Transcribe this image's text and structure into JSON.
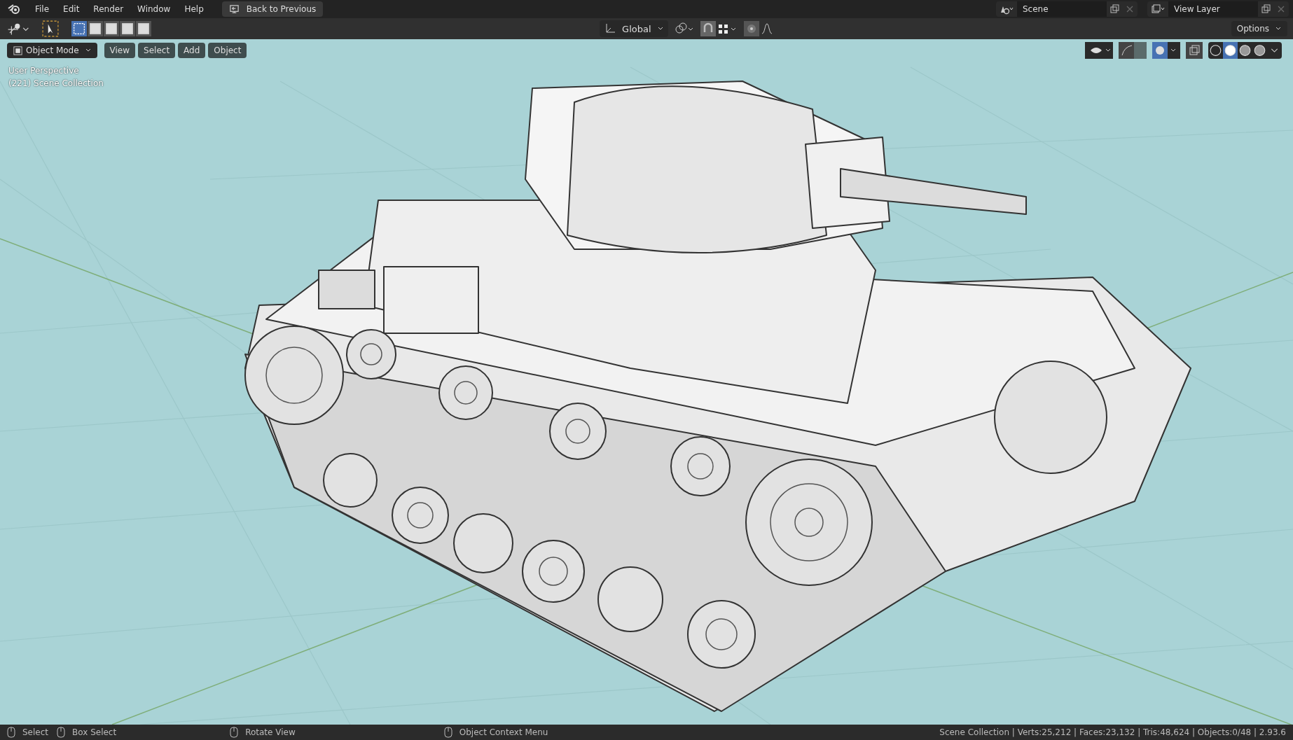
{
  "top_bar": {
    "menus": [
      "File",
      "Edit",
      "Render",
      "Window",
      "Help"
    ],
    "back_button": "Back to Previous",
    "scene": "Scene",
    "view_layer": "View Layer"
  },
  "tool_header": {
    "select_modes": [
      {
        "selected": true
      },
      {
        "selected": false
      },
      {
        "selected": false
      },
      {
        "selected": false
      },
      {
        "selected": false
      }
    ],
    "orientation": "Global",
    "options": "Options"
  },
  "viewport_header": {
    "mode": "Object Mode",
    "menus": [
      "View",
      "Select",
      "Add",
      "Object"
    ],
    "shading_modes": [
      {
        "selected": false
      },
      {
        "selected": true
      },
      {
        "selected": false
      },
      {
        "selected": false
      }
    ]
  },
  "viewport": {
    "overlay_lines": [
      "User Perspective",
      "(221) Scene Collection"
    ]
  },
  "status_bar": {
    "hints": [
      {
        "label": "Select"
      },
      {
        "label": "Box Select"
      },
      {
        "label": "Rotate View"
      },
      {
        "label": "Object Context Menu"
      }
    ],
    "stats": "Scene Collection | Verts:25,212 | Faces:23,132 | Tris:48,624 | Objects:0/48 | 2.93.6"
  }
}
